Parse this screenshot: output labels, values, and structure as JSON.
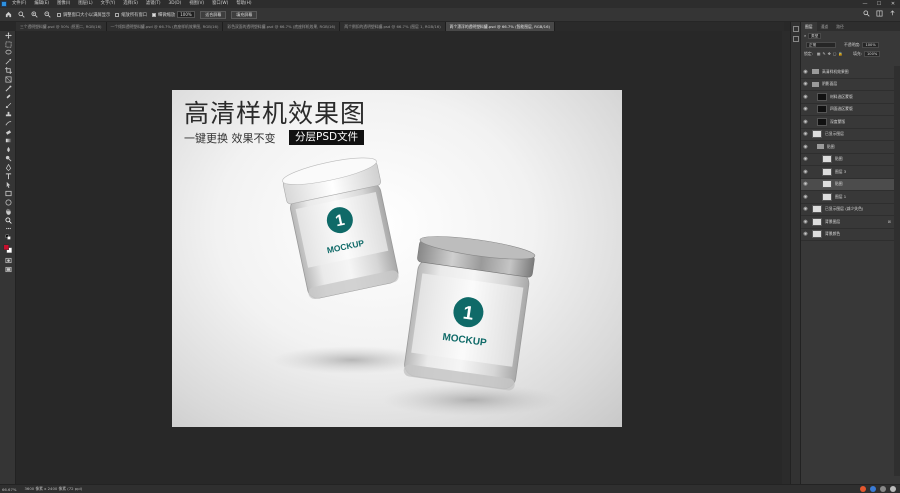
{
  "menubar": {
    "items": [
      "文件(F)",
      "编辑(E)",
      "图像(I)",
      "图层(L)",
      "文字(Y)",
      "选择(S)",
      "滤镜(T)",
      "3D(D)",
      "视图(V)",
      "窗口(W)",
      "帮助(H)"
    ],
    "window_controls": [
      "—",
      "☐",
      "✕"
    ]
  },
  "optionsbar": {
    "resize_windows_label": "调整窗口大小以满屏显示",
    "zoom_all_label": "缩放所有窗口",
    "scrubby_zoom_label": "细微缩放",
    "zoom_value": "100%",
    "fit_screen_label": "适合屏幕",
    "fill_screen_label": "填充屏幕"
  },
  "tabs": [
    {
      "label": "三个透明塑料罐.psd @ 50% (抠图二, RGB/16)",
      "active": false
    },
    {
      "label": "一个倾斜透明塑料罐.psd @ 66.7% (底座样机效果图, RGB/16)",
      "active": false
    },
    {
      "label": "彩色双面的透明塑料罐.psd @ 66.7% (底座样机效果, RGB/16)",
      "active": false
    },
    {
      "label": "两个倒扣的透明塑料罐.psd @ 66.7% (图层 1, RGB/16)",
      "active": false
    },
    {
      "label": "两个漂浮的透明塑料罐.psd @ 66.7% (智能图层, RGB/16)",
      "active": true
    }
  ],
  "document": {
    "title": "高清样机效果图",
    "subtitle": "一键更换  效果不变",
    "tag": "分层PSD文件",
    "jar_front": {
      "badge_number": "1",
      "badge_text": "MOCKUP"
    },
    "jar_back": {
      "badge_number": "1",
      "badge_text": "MOCKUP"
    }
  },
  "panel": {
    "tabs": [
      "图层",
      "通道",
      "路径"
    ],
    "kind_label": "类型",
    "blend_mode": "正常",
    "opacity_label": "不透明度:",
    "opacity_value": "100%",
    "lock_label": "锁定:",
    "fill_label": "填充:",
    "fill_value": "100%",
    "layers": [
      {
        "label": "高清样机效果图",
        "type": "folder",
        "selected": false,
        "indent": 0
      },
      {
        "label": "阴影面层",
        "type": "folder",
        "selected": false,
        "indent": 0
      },
      {
        "label": "材料选区蒙版",
        "type": "dark",
        "selected": false,
        "indent": 1
      },
      {
        "label": "四面选区蒙版",
        "type": "dark",
        "selected": false,
        "indent": 1
      },
      {
        "label": "深度蒙版",
        "type": "dark",
        "selected": false,
        "indent": 1
      },
      {
        "label": "已显示图层",
        "type": "light",
        "selected": false,
        "indent": 0
      },
      {
        "label": "贴图",
        "type": "folder",
        "selected": false,
        "indent": 1
      },
      {
        "label": "贴图",
        "type": "light",
        "selected": false,
        "indent": 2
      },
      {
        "label": "图层 3",
        "type": "light",
        "selected": false,
        "indent": 2
      },
      {
        "label": "贴图",
        "type": "light",
        "selected": true,
        "indent": 2
      },
      {
        "label": "图层 1",
        "type": "light",
        "selected": false,
        "indent": 2
      },
      {
        "label": "已显示图层 (减少失色)",
        "type": "light",
        "selected": false,
        "indent": 0
      },
      {
        "label": "背景图层",
        "type": "light",
        "selected": false,
        "indent": 0,
        "locked": true
      },
      {
        "label": "背景颜色",
        "type": "light",
        "selected": false,
        "indent": 0
      }
    ]
  },
  "statusbar": {
    "zoom": "66.67%",
    "docinfo": "3600 像素 x 2400 像素 (72 ppi)"
  },
  "colors": {
    "accent_teal": "#0f6a68",
    "foreground": "#c8102e",
    "background": "#ffffff"
  }
}
